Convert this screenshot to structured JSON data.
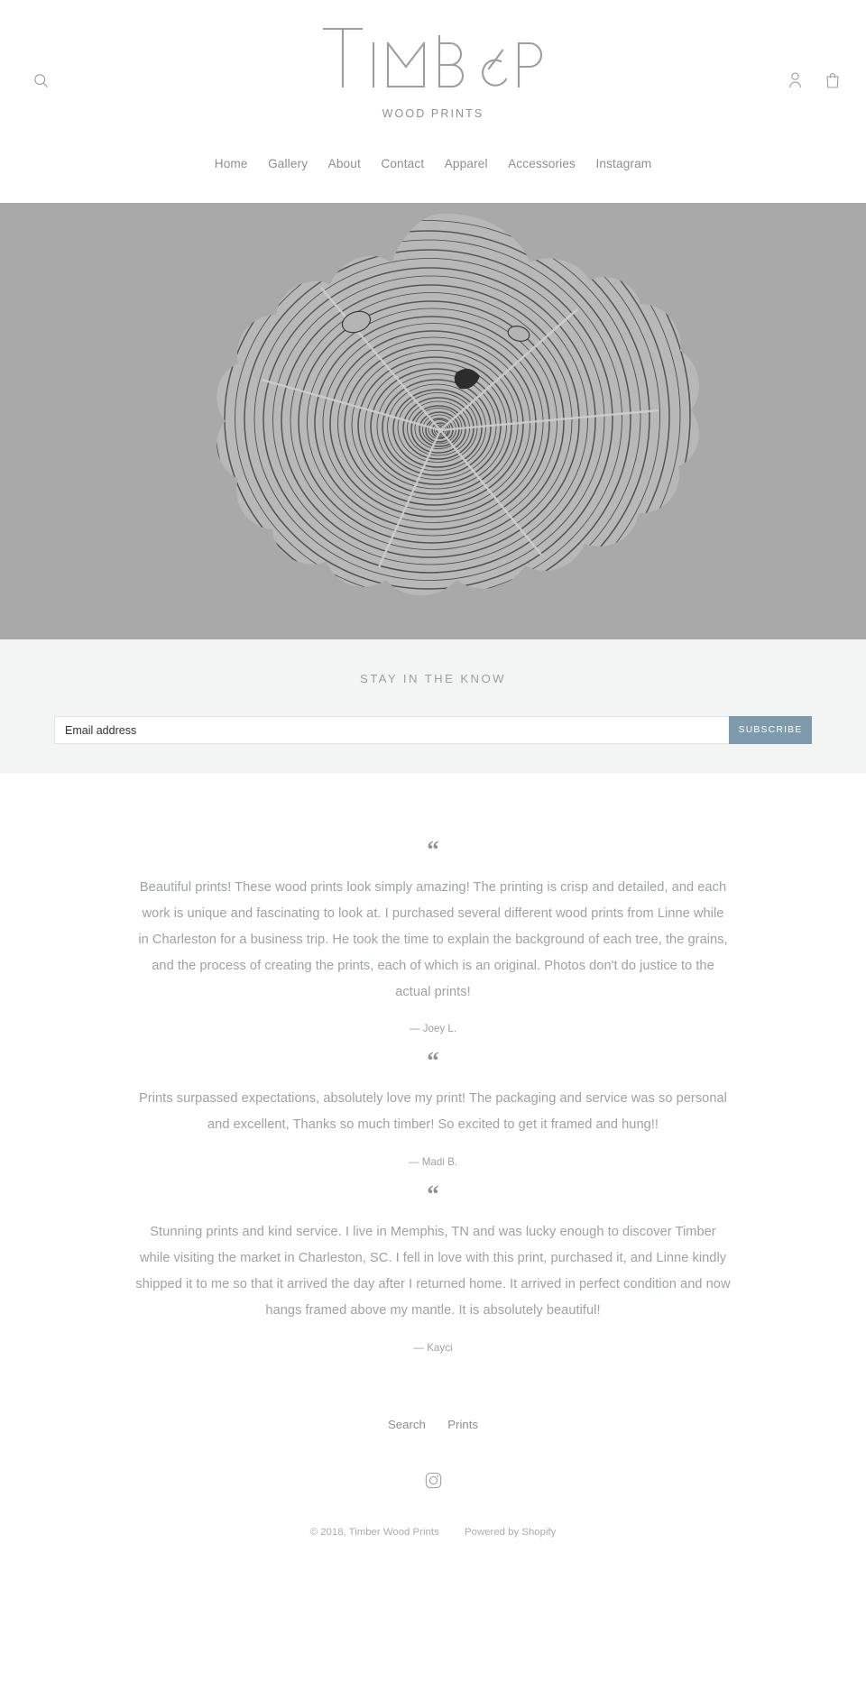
{
  "header": {
    "logo_text": "TIMBER",
    "tagline": "WOOD PRINTS",
    "search_label": "Search",
    "account_label": "Log in",
    "cart_label": "Cart",
    "icons": {
      "search": "search-icon",
      "account": "person-icon",
      "cart": "shopping-bag-icon"
    }
  },
  "nav": {
    "items": [
      {
        "label": "Home"
      },
      {
        "label": "Gallery"
      },
      {
        "label": "About"
      },
      {
        "label": "Contact"
      },
      {
        "label": "Apparel"
      },
      {
        "label": "Accessories"
      },
      {
        "label": "Instagram"
      }
    ]
  },
  "hero": {
    "alt": "Tree ring cross-section wood print",
    "background_color": "#a9a9a9",
    "ink_color": "#2e2e2e"
  },
  "newsletter": {
    "heading": "STAY IN THE KNOW",
    "email_placeholder": "Email address",
    "email_value": "",
    "subscribe_label": "SUBSCRIBE",
    "button_color": "#7e9bad",
    "background_color": "#f3f5f5"
  },
  "testimonials": {
    "quote_glyph": "“",
    "items": [
      {
        "text": "Beautiful prints! These wood prints look simply amazing! The printing is crisp and detailed, and each work is unique and fascinating to look at. I purchased several different wood prints from Linne while in Charleston for a business trip. He took the time to explain the background of each tree, the grains, and the process of creating the prints, each of which is an original. Photos don't do justice to the actual prints!",
        "author": "— Joey L."
      },
      {
        "text": "Prints surpassed expectations, absolutely love my print! The packaging and service was so personal and excellent, Thanks so much timber! So excited to get it framed and hung!!",
        "author": "— Madi B."
      },
      {
        "text": "Stunning prints and kind service. I live in Memphis, TN and was lucky enough to discover Timber while visiting the market in Charleston, SC. I fell in love with this print, purchased it, and Linne kindly shipped it to me so that it arrived the day after I returned home. It arrived in perfect condition and now hangs framed above my mantle. It is absolutely beautiful!",
        "author": "— Kayci"
      }
    ]
  },
  "footer": {
    "links": [
      {
        "label": "Search"
      },
      {
        "label": "Prints"
      }
    ],
    "social": [
      {
        "name": "instagram-icon",
        "label": "Instagram"
      }
    ],
    "copyright": "© 2018, Timber Wood Prints",
    "powered_by": "Powered by Shopify"
  }
}
